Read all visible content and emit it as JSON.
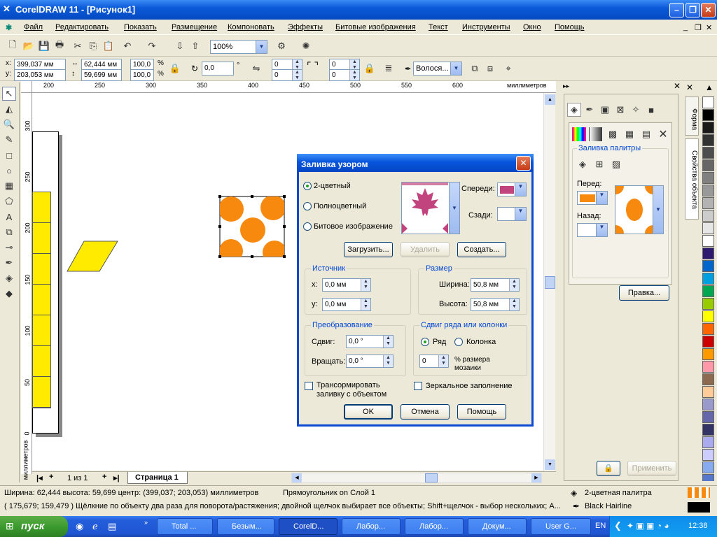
{
  "window": {
    "title": "CorelDRAW 11 - [Рисунок1]"
  },
  "menu": [
    "Файл",
    "Редактировать",
    "Показать",
    "Размещение",
    "Компоновать",
    "Эффекты",
    "Битовые изображения",
    "Текст",
    "Инструменты",
    "Окно",
    "Помощь"
  ],
  "toolbar": {
    "zoom": "100%"
  },
  "propbar": {
    "x": "399,037 мм",
    "y": "203,053 мм",
    "w": "62,444 мм",
    "h": "59,699 мм",
    "sx": "100,0",
    "sy": "100,0",
    "pct": "%",
    "angle": "0,0",
    "deg": "°",
    "c1": "0",
    "c2": "0",
    "c3": "0",
    "c4": "0",
    "outline": "Волося..."
  },
  "ruler": {
    "unit": "миллиметров",
    "vunit": "миллиметров",
    "h_ticks": [
      "200",
      "250",
      "300",
      "350",
      "400",
      "450",
      "500",
      "550",
      "600"
    ],
    "v_ticks": [
      "300",
      "250",
      "200",
      "150",
      "100",
      "50",
      "0"
    ]
  },
  "page_nav": {
    "counter": "1 из 1",
    "tab": "Страница 1"
  },
  "dialog": {
    "title": "Заливка узором",
    "radio_2color": "2-цветный",
    "radio_full": "Полноцветный",
    "radio_bitmap": "Битовое изображение",
    "front_label": "Спереди:",
    "back_label": "Сзади:",
    "load": "Загрузить...",
    "delete": "Удалить",
    "create": "Создать...",
    "source": {
      "legend": "Источник",
      "x_label": "x:",
      "x": "0,0 мм",
      "y_label": "y:",
      "y": "0,0 мм"
    },
    "size": {
      "legend": "Размер",
      "w_label": "Ширина:",
      "w": "50,8 мм",
      "h_label": "Высота:",
      "h": "50,8 мм"
    },
    "transform": {
      "legend": "Преобразование",
      "skew_label": "Сдвиг:",
      "skew": "0,0 °",
      "rotate_label": "Вращать:",
      "rotate": "0,0 °"
    },
    "offset": {
      "legend": "Сдвиг ряда или колонки",
      "row": "Ряд",
      "col": "Колонка",
      "value": "0",
      "pct_label": "% размера",
      "pct_label2": "мозаики"
    },
    "transform_chk": "Трансормировать",
    "transform_chk2": "заливку с объектом",
    "mirror_chk": "Зеркальное заполнение",
    "ok": "OK",
    "cancel": "Отмена",
    "help": "Помощь"
  },
  "docker": {
    "section": "Заливка палитры",
    "front": "Перед:",
    "back": "Назад:",
    "edit": "Правка...",
    "apply": "Применить",
    "tab1": "Форма",
    "tab2": "Свойства объекта"
  },
  "palette": [
    "#ffffff",
    "#000000",
    "#1a1a1a",
    "#333333",
    "#4d4d4d",
    "#666666",
    "#808080",
    "#999999",
    "#b3b3b3",
    "#cccccc",
    "#e6e6e6",
    "#ffffff",
    "#2e1a6e",
    "#0066cc",
    "#00a0e0",
    "#00a650",
    "#99cc00",
    "#ffff00",
    "#ff6600",
    "#cc0000",
    "#ff9900",
    "#ff99aa",
    "#8c6a4f",
    "#ffcc99",
    "#9999cc",
    "#6666aa",
    "#333366",
    "#aaaaee",
    "#ccccff",
    "#88aaee",
    "#5577cc"
  ],
  "status": {
    "info": "Ширина: 62,444  высота: 59,699  центр: (399,037; 203,053)  миллиметров",
    "layer": "Прямоугольник on Слой 1",
    "fill": "2-цветная палитра",
    "hint": "( 175,679; 159,479 )   Щёлкние по объекту два раза для поворота/растяжения; двойной щелчок выбирает все объекты; Shift+щелчок - выбор нескольких; А...",
    "outline": "Black  Hairline"
  },
  "taskbar": {
    "start": "пуск",
    "tasks": [
      "Total ...",
      "Безым...",
      "CorelD...",
      "Лабор...",
      "Лабор...",
      "Докум...",
      "User G..."
    ],
    "lang": "EN",
    "time": "12:38"
  }
}
